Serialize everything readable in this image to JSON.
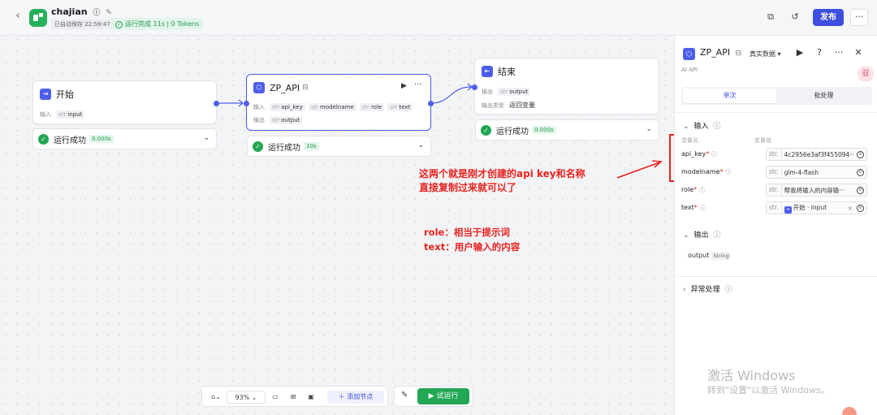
{
  "header": {
    "back_icon": "chevron-left-icon",
    "app_name": "chajian",
    "saved_text": "已自动保存 22:56:47",
    "run_status": "运行完成 11s | 0 Tokens",
    "publish_label": "发布",
    "more_label": "···"
  },
  "nodes": {
    "start": {
      "title": "开始",
      "input_label": "输入",
      "input_var": "input",
      "status": "运行成功",
      "time": "0.000s"
    },
    "zp_api": {
      "title": "ZP_API",
      "input_label": "输入",
      "inputs": [
        "api_key",
        "modelname",
        "role",
        "text"
      ],
      "output_label": "输出",
      "output_var": "output",
      "status": "运行成功",
      "time": "10s"
    },
    "end": {
      "title": "结束",
      "output_label": "输出",
      "output_var": "output",
      "output_type_label": "输出类型",
      "output_type_value": "返回变量",
      "status": "运行成功",
      "time": "0.000s"
    }
  },
  "type_tag": "str",
  "annotations": {
    "line1": "这两个就是刚才创建的api key和名称",
    "line2": "直接复制过来就可以了",
    "line3": "role：相当于提示词",
    "line4": "text：用户输入的内容"
  },
  "panel": {
    "title": "ZP_API",
    "mode": "真实数据 ▾",
    "subtitle": "AI API",
    "avatar_text": "驭",
    "tabs": [
      "单次",
      "批处理"
    ],
    "input_section": "输入",
    "col_name": "变量名",
    "col_value": "变量值",
    "params": [
      {
        "name": "api_key",
        "type": "str.",
        "value": "4c2956e3af3f455094···"
      },
      {
        "name": "modelname",
        "type": "str.",
        "value": "glm-4-flash"
      },
      {
        "name": "role",
        "type": "str.",
        "value": "帮我将输入的内容输···"
      },
      {
        "name": "text",
        "type": "str.",
        "value": "开始 · input"
      }
    ],
    "output_section": "输出",
    "output_name": "output",
    "output_type": "String",
    "exception_section": "异常处理",
    "watermark_title": "激活 Windows",
    "watermark_sub": "转到\"设置\"以激活 Windows。"
  },
  "bottom_bar": {
    "zoom": "93%",
    "add_node": "添加节点",
    "run": "试运行"
  },
  "colors": {
    "accent": "#3d4ee0",
    "success": "#22a755",
    "annotation": "#e8231f"
  }
}
